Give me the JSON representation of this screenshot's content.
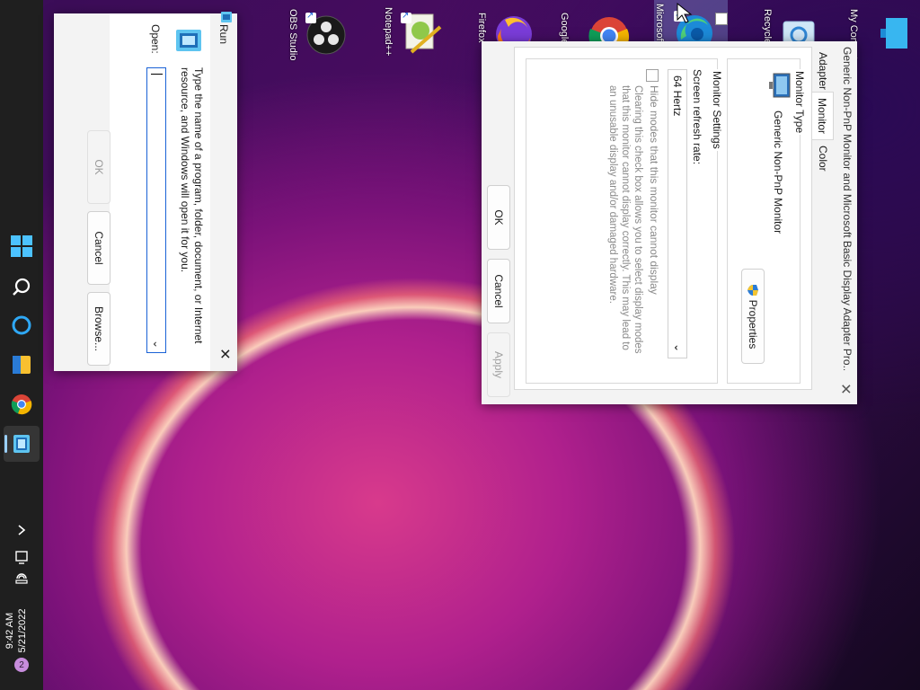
{
  "desktop": {
    "icons": [
      {
        "label": "My Computer",
        "icon": "monitor-icon"
      },
      {
        "label": "Recycle Bin",
        "icon": "recycle-bin-icon"
      },
      {
        "label": "Microsoft Edge",
        "icon": "edge-icon"
      },
      {
        "label": "Google Chrome",
        "icon": "chrome-icon"
      },
      {
        "label": "Firefox",
        "icon": "firefox-icon"
      },
      {
        "label": "Notepad++",
        "icon": "notepadpp-icon"
      },
      {
        "label": "OBS Studio",
        "icon": "obs-icon"
      }
    ]
  },
  "run": {
    "title": "Run",
    "description": "Type the name of a program, folder, document, or Internet resource, and Windows will open it for you.",
    "open_label": "Open:",
    "open_value": "",
    "ok": "OK",
    "cancel": "Cancel",
    "browse": "Browse..."
  },
  "props": {
    "title": "Generic Non-PnP Monitor and Microsoft Basic Display Adapter Pro...",
    "tabs": [
      "Adapter",
      "Monitor",
      "Color Management"
    ],
    "monitor_type_label": "Monitor Type",
    "monitor_name": "Generic Non-PnP Monitor",
    "properties_button": "Properties",
    "monitor_settings_label": "Monitor Settings",
    "refresh_label": "Screen refresh rate:",
    "refresh_value": "64 Hertz",
    "hide_modes_label": "Hide modes that this monitor cannot display",
    "hide_modes_desc": "Clearing this check box allows you to select display modes that this monitor cannot display correctly. This may lead to an unusable display and/or damaged hardware.",
    "ok": "OK",
    "cancel": "Cancel",
    "apply": "Apply"
  },
  "taskbar": {
    "time": "9:42 AM",
    "date": "5/21/2022",
    "notification_count": "2"
  },
  "colors": {
    "accent": "#1a62d6",
    "taskbar": "#1f1f1f"
  }
}
